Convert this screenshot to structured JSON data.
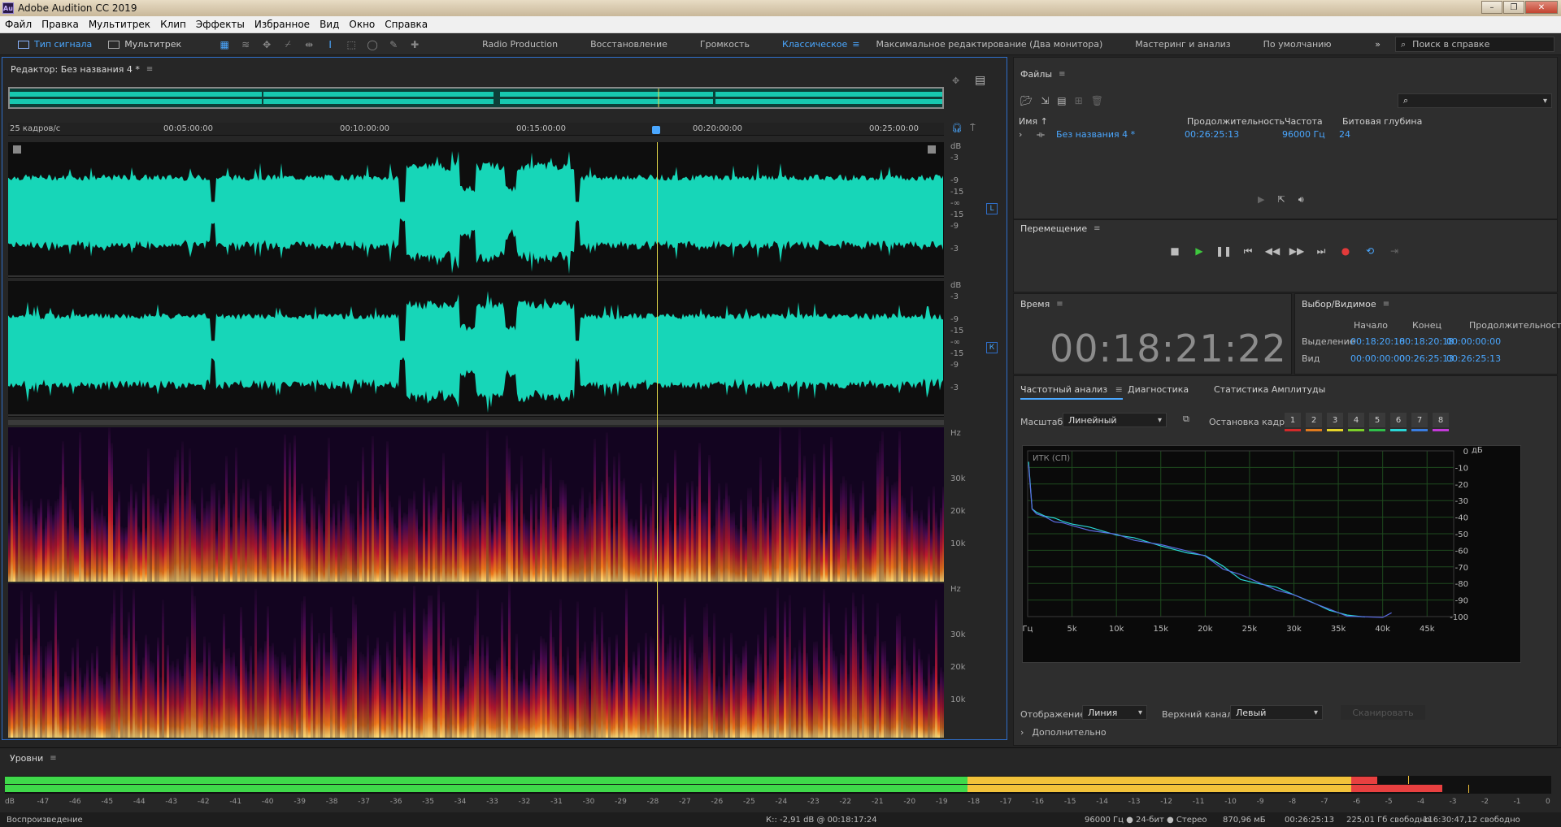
{
  "titlebar": {
    "app_title": "Adobe Audition CC 2019",
    "logo": "Au"
  },
  "menu": [
    "Файл",
    "Правка",
    "Мультитрек",
    "Клип",
    "Эффекты",
    "Избранное",
    "Вид",
    "Окно",
    "Справка"
  ],
  "toolbar": {
    "modes": [
      {
        "label": "Тип сигнала",
        "active": true
      },
      {
        "label": "Мультитрек",
        "active": false
      }
    ],
    "workspaces": [
      {
        "label": "Radio Production",
        "active": false
      },
      {
        "label": "Восстановление",
        "active": false
      },
      {
        "label": "Громкость",
        "active": false
      },
      {
        "label": "Классическое",
        "active": true
      },
      {
        "label": "Максимальное редактирование (Два монитора)",
        "active": false
      },
      {
        "label": "Мастеринг и анализ",
        "active": false
      },
      {
        "label": "По умолчанию",
        "active": false
      }
    ],
    "search_placeholder": "Поиск в справке"
  },
  "editor": {
    "title": "Редактор: Без названия 4 *",
    "fps_label": "25 кадров/с",
    "ruler_ticks": [
      "00:05:00:00",
      "00:10:00:00",
      "00:15:00:00",
      "00:20:00:00",
      "00:25:00:00"
    ],
    "db_unit": "dB",
    "db_ticks": [
      "-3",
      "-9",
      "-15",
      "-∞",
      "-15",
      "-9",
      "-3"
    ],
    "channel_left": "L",
    "channel_right": "К",
    "hz_unit": "Hz",
    "hz_ticks": [
      "30k",
      "20k",
      "10k"
    ],
    "playhead_fraction": 0.701
  },
  "files": {
    "title": "Файлы",
    "columns": [
      "Имя ↑",
      "Продолжительность",
      "Частота",
      "Битовая глубина"
    ],
    "rows": [
      {
        "name": "Без названия 4 *",
        "duration": "00:26:25:13",
        "rate": "96000 Гц",
        "depth": "24"
      }
    ]
  },
  "transport": {
    "title": "Перемещение"
  },
  "time": {
    "title": "Время",
    "value": "00:18:21:22"
  },
  "selection": {
    "title": "Выбор/Видимое",
    "headers": [
      "Начало",
      "Конец",
      "Продолжительность"
    ],
    "rows": [
      {
        "label": "Выделение",
        "start": "00:18:20:18",
        "end": "00:18:20:18",
        "dur": "00:00:00:00"
      },
      {
        "label": "Вид",
        "start": "00:00:00:00",
        "end": "00:26:25:13",
        "dur": "00:26:25:13"
      }
    ]
  },
  "analysis": {
    "tabs": [
      {
        "label": "Частотный анализ",
        "active": true
      },
      {
        "label": "Диагностика",
        "active": false
      },
      {
        "label": "Статистика Амплитуды",
        "active": false
      }
    ],
    "scale_label": "Масштаб:",
    "scale_value": "Линейный",
    "freeze_label": "Остановка кадра:",
    "freeze_buttons": [
      "1",
      "2",
      "3",
      "4",
      "5",
      "6",
      "7",
      "8"
    ],
    "freeze_colors": [
      "#d22a2a",
      "#e07a1e",
      "#e6d42a",
      "#7ccf2a",
      "#2fbf4a",
      "#2ad6d6",
      "#3a7de0",
      "#c23ad8"
    ],
    "graph_title": "ИТК (СП)",
    "db_label": "дБ",
    "db_ticks": [
      "0",
      "-10",
      "-20",
      "-30",
      "-40",
      "-50",
      "-60",
      "-70",
      "-80",
      "-90",
      "-100"
    ],
    "x_ticks": [
      "Гц",
      "5k",
      "10k",
      "15k",
      "20k",
      "25k",
      "30k",
      "35k",
      "40k",
      "45k"
    ],
    "display_label": "Отображение:",
    "display_value": "Линия",
    "channel_label": "Верхний канал:",
    "channel_value": "Левый",
    "scan_button": "Сканировать",
    "more_label": "Дополнительно"
  },
  "chart_data": {
    "type": "line",
    "title": "ИТК (СП)",
    "xlabel": "Гц",
    "ylabel": "дБ",
    "xlim": [
      0,
      48000
    ],
    "ylim": [
      -100,
      0
    ],
    "series": [
      {
        "values": [
          [
            100,
            -7
          ],
          [
            500,
            -35
          ],
          [
            1000,
            -38
          ],
          [
            2000,
            -39
          ],
          [
            3000,
            -41
          ],
          [
            4000,
            -43
          ],
          [
            5000,
            -45
          ],
          [
            7000,
            -47
          ],
          [
            10000,
            -51
          ],
          [
            12000,
            -52
          ],
          [
            15000,
            -58
          ],
          [
            18000,
            -61
          ],
          [
            20000,
            -64
          ],
          [
            22000,
            -70
          ],
          [
            24000,
            -77
          ],
          [
            26000,
            -80
          ],
          [
            28000,
            -82
          ],
          [
            30000,
            -86
          ],
          [
            32000,
            -91
          ],
          [
            34000,
            -96
          ],
          [
            36000,
            -99
          ],
          [
            38000,
            -100
          ]
        ]
      },
      {
        "values": [
          [
            100,
            -8
          ],
          [
            500,
            -36
          ],
          [
            1000,
            -39
          ],
          [
            2000,
            -40
          ],
          [
            3000,
            -42
          ],
          [
            4000,
            -44
          ],
          [
            5000,
            -46
          ],
          [
            7000,
            -48
          ],
          [
            10000,
            -50
          ],
          [
            12000,
            -53
          ],
          [
            15000,
            -57
          ],
          [
            18000,
            -60
          ],
          [
            20000,
            -63
          ],
          [
            22000,
            -71
          ],
          [
            24000,
            -74
          ],
          [
            26000,
            -79
          ],
          [
            28000,
            -83
          ],
          [
            30000,
            -87
          ],
          [
            32000,
            -92
          ],
          [
            34000,
            -95
          ],
          [
            36000,
            -99
          ],
          [
            40000,
            -100
          ],
          [
            41000,
            -98
          ]
        ]
      }
    ]
  },
  "levels": {
    "title": "Уровни",
    "ticks": [
      "dB",
      "-47",
      "-46",
      "-45",
      "-44",
      "-43",
      "-42",
      "-41",
      "-40",
      "-39",
      "-38",
      "-37",
      "-36",
      "-35",
      "-34",
      "-33",
      "-32",
      "-31",
      "-30",
      "-29",
      "-28",
      "-27",
      "-26",
      "-25",
      "-24",
      "-23",
      "-22",
      "-21",
      "-20",
      "-19",
      "-18",
      "-17",
      "-16",
      "-15",
      "-14",
      "-13",
      "-12",
      "-11",
      "-10",
      "-9",
      "-8",
      "-7",
      "-6",
      "-5",
      "-4",
      "-3",
      "-2",
      "-1",
      "0"
    ]
  },
  "status": {
    "left": "Воспроизведение",
    "cursor": "К:: -2,91 dB @ 00:18:17:24",
    "format": "96000 Гц ● 24-бит ● Стерео",
    "size": "870,96 мБ",
    "duration": "00:26:25:13",
    "free": "225,01 Гб свободно",
    "free_time": "116:30:47,12 свободно"
  }
}
